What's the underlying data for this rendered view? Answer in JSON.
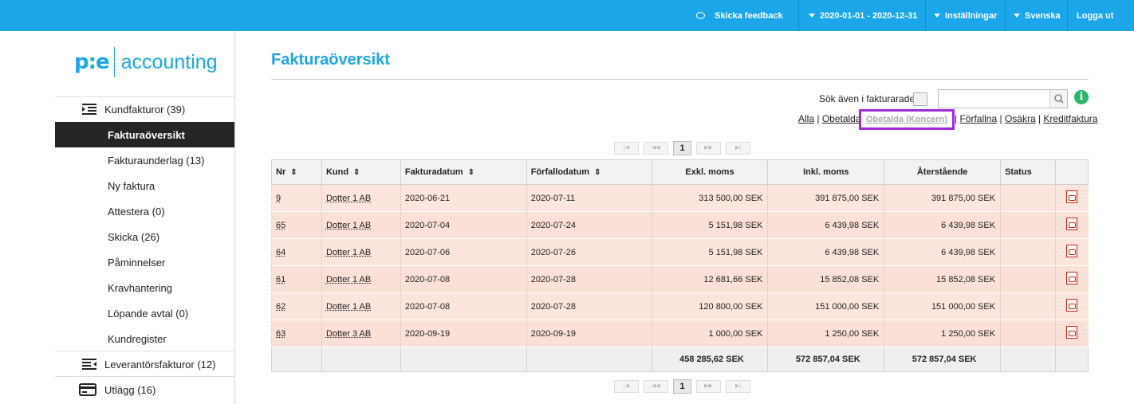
{
  "topbar": {
    "feedback": "Skicka feedback",
    "period": "2020-01-01 - 2020-12-31",
    "settings": "Inställningar",
    "language": "Svenska",
    "logout": "Logga ut"
  },
  "logo": {
    "mark": "p:e",
    "text": "accounting"
  },
  "sidebar": {
    "customer_invoices": "Kundfakturor (39)",
    "items": [
      "Fakturaöversikt",
      "Fakturaunderlag (13)",
      "Ny faktura",
      "Attestera (0)",
      "Skicka (26)",
      "Påminnelser",
      "Kravhantering",
      "Löpande avtal (0)",
      "Kundregister"
    ],
    "supplier_invoices": "Leverantörsfakturor (12)",
    "expenses": "Utlägg (16)"
  },
  "page": {
    "title": "Fakturaöversikt"
  },
  "search": {
    "label": "Sök även i fakturarader",
    "placeholder": ""
  },
  "filters": {
    "all": "Alla",
    "unpaid": "Obetalda",
    "unpaid_group": "Obetalda (Koncern)",
    "overdue": "Förfallna",
    "uncertain": "Osäkra",
    "credit": "Kreditfaktura"
  },
  "pager": {
    "first": "|◀",
    "prev": "◀◀",
    "page": "1",
    "next": "▶▶",
    "last": "▶|"
  },
  "table": {
    "headers": [
      "Nr",
      "Kund",
      "Fakturadatum",
      "Förfallodatum",
      "Exkl. moms",
      "Inkl. moms",
      "Återstående",
      "Status"
    ],
    "rows": [
      [
        "9",
        "Dotter 1 AB",
        "2020-06-21",
        "2020-07-11",
        "313 500,00 SEK",
        "391 875,00 SEK",
        "391 875,00 SEK"
      ],
      [
        "65",
        "Dotter 1 AB",
        "2020-07-04",
        "2020-07-24",
        "5 151,98 SEK",
        "6 439,98 SEK",
        "6 439,98 SEK"
      ],
      [
        "64",
        "Dotter 1 AB",
        "2020-07-06",
        "2020-07-26",
        "5 151,98 SEK",
        "6 439,98 SEK",
        "6 439,98 SEK"
      ],
      [
        "61",
        "Dotter 1 AB",
        "2020-07-08",
        "2020-07-28",
        "12 681,66 SEK",
        "15 852,08 SEK",
        "15 852,08 SEK"
      ],
      [
        "62",
        "Dotter 1 AB",
        "2020-07-08",
        "2020-07-28",
        "120 800,00 SEK",
        "151 000,00 SEK",
        "151 000,00 SEK"
      ],
      [
        "63",
        "Dotter 3 AB",
        "2020-09-19",
        "2020-09-19",
        "1 000,00 SEK",
        "1 250,00 SEK",
        "1 250,00 SEK"
      ]
    ],
    "totals": [
      "458 285,62 SEK",
      "572 857,04 SEK",
      "572 857,04 SEK"
    ]
  },
  "colors": {
    "accent": "#1aa6e8",
    "highlight": "#a12ad6",
    "row": "#fbe5dd"
  }
}
